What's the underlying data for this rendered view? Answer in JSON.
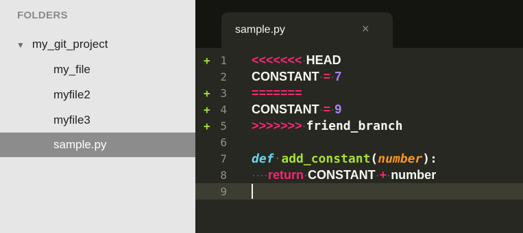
{
  "sidebar": {
    "header": "FOLDERS",
    "folder": {
      "disclosure": "▼",
      "name": "my_git_project"
    },
    "files": [
      "my_file",
      "myfile2",
      "myfile3",
      "sample.py"
    ],
    "selected": "sample.py"
  },
  "tab": {
    "title": "sample.py",
    "close": "×"
  },
  "gutter": {
    "numbers": [
      "1",
      "2",
      "3",
      "4",
      "5",
      "6",
      "7",
      "8",
      "9"
    ],
    "added_mark": "+"
  },
  "code": {
    "l1": {
      "marker": "<<<<<<<",
      "ws": "·",
      "label": "HEAD"
    },
    "l2": {
      "name": "CONSTANT",
      "ws1": "·",
      "op": "=",
      "ws2": "·",
      "value": "7"
    },
    "l3": {
      "marker": "======="
    },
    "l4": {
      "name": "CONSTANT",
      "ws1": "·",
      "op": "=",
      "ws2": "·",
      "value": "9"
    },
    "l5": {
      "marker": ">>>>>>>",
      "ws": "·",
      "label": "friend_branch"
    },
    "l7": {
      "kw": "def",
      "ws": "·",
      "fn": "add_constant",
      "open": "(",
      "param": "number",
      "close": "):"
    },
    "l8": {
      "indent": "····",
      "kw": "return",
      "ws1": "·",
      "name": "CONSTANT",
      "ws2": "·",
      "op": "+",
      "ws3": "·",
      "var": "number"
    }
  },
  "colors": {
    "sidebar_bg": "#e6e6e6",
    "selected_bg": "#8c8c8c",
    "editor_bg": "#272822",
    "current_line_bg": "#3e3d32",
    "keyword_pink": "#f92672",
    "number_purple": "#ae81ff",
    "function_green": "#a6e22e",
    "storage_cyan": "#66d9ef",
    "param_orange": "#fd971f"
  }
}
